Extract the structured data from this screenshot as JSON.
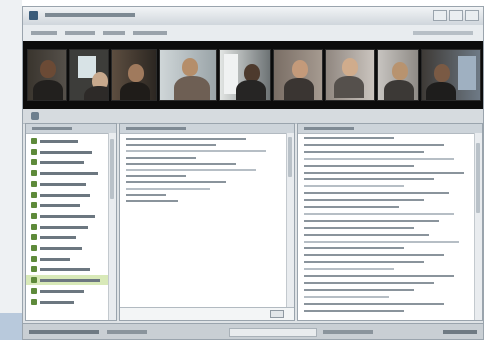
{
  "colors": {
    "window_bg": "#dfe3e6",
    "video_strip_bg": "#0c0c0c",
    "pane_bg": "#ffffff",
    "selected_row": "#d8e9b8",
    "status_bar": "#c9cfd4"
  },
  "icons": {
    "app": "app-icon",
    "contact": "contact-status-icon",
    "send": "send-button-icon"
  },
  "window": {
    "title": ""
  },
  "contacts": {
    "selected_index": 13
  }
}
